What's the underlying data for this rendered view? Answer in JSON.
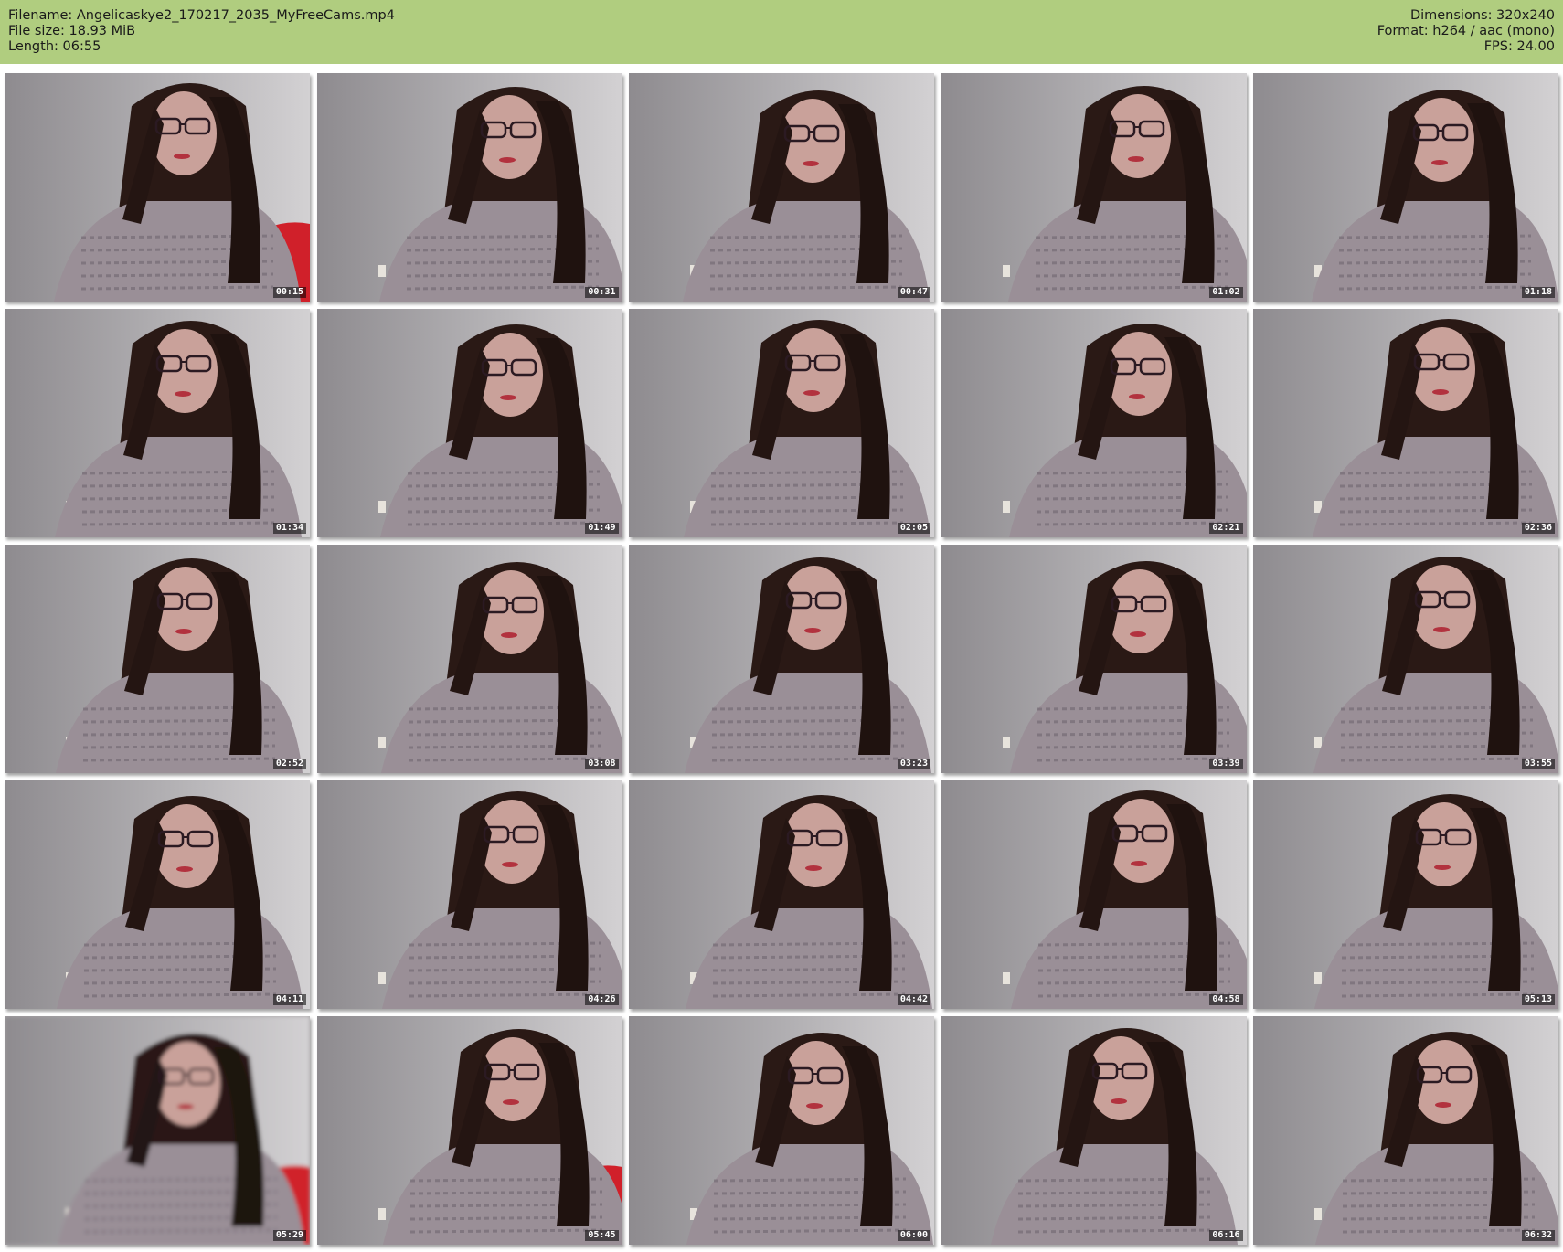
{
  "header": {
    "filename_line": "Filename: Angelicaskye2_170217_2035_MyFreeCams.mp4",
    "filesize_line": "File size: 18.93 MiB",
    "length_line": "Length: 06:55",
    "dimensions_line": "Dimensions: 320x240",
    "format_line": "Format: h264 / aac (mono)",
    "fps_line": "FPS: 24.00"
  },
  "colors": {
    "header_bg": "#b0cd7f",
    "wall": "#b3b1b4",
    "hair": "#2a1915",
    "skin": "#c9a19a",
    "shirt": "#9a8f97"
  },
  "thumbnails": [
    {
      "timestamp": "00:15",
      "variant": "red-left"
    },
    {
      "timestamp": "00:31",
      "variant": "normal"
    },
    {
      "timestamp": "00:47",
      "variant": "normal"
    },
    {
      "timestamp": "01:02",
      "variant": "normal"
    },
    {
      "timestamp": "01:18",
      "variant": "normal"
    },
    {
      "timestamp": "01:34",
      "variant": "normal"
    },
    {
      "timestamp": "01:49",
      "variant": "normal"
    },
    {
      "timestamp": "02:05",
      "variant": "normal"
    },
    {
      "timestamp": "02:21",
      "variant": "normal"
    },
    {
      "timestamp": "02:36",
      "variant": "normal"
    },
    {
      "timestamp": "02:52",
      "variant": "normal"
    },
    {
      "timestamp": "03:08",
      "variant": "normal"
    },
    {
      "timestamp": "03:23",
      "variant": "normal"
    },
    {
      "timestamp": "03:39",
      "variant": "normal"
    },
    {
      "timestamp": "03:55",
      "variant": "normal"
    },
    {
      "timestamp": "04:11",
      "variant": "normal"
    },
    {
      "timestamp": "04:26",
      "variant": "normal"
    },
    {
      "timestamp": "04:42",
      "variant": "normal"
    },
    {
      "timestamp": "04:58",
      "variant": "normal"
    },
    {
      "timestamp": "05:13",
      "variant": "normal"
    },
    {
      "timestamp": "05:29",
      "variant": "blur-red"
    },
    {
      "timestamp": "05:45",
      "variant": "chair-red"
    },
    {
      "timestamp": "06:00",
      "variant": "normal"
    },
    {
      "timestamp": "06:16",
      "variant": "normal"
    },
    {
      "timestamp": "06:32",
      "variant": "normal"
    }
  ]
}
